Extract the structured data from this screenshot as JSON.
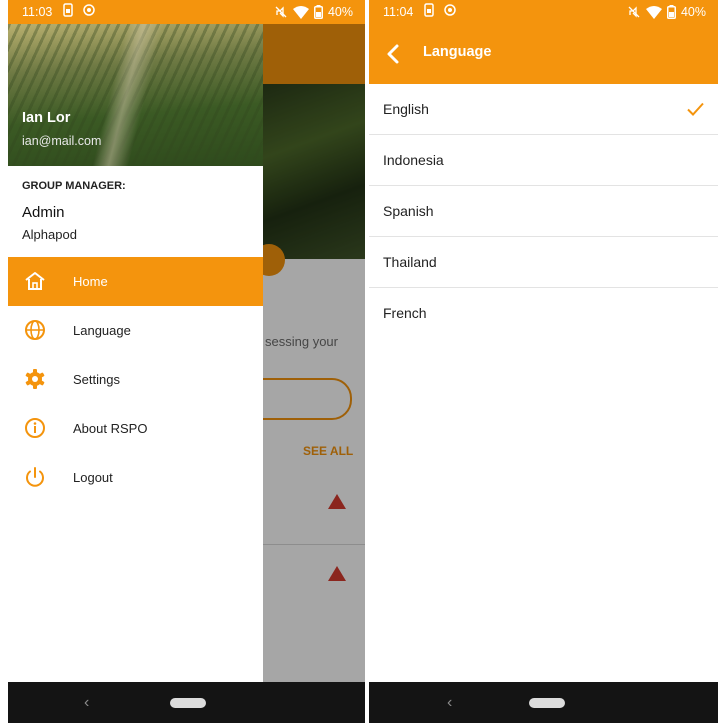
{
  "left_screen": {
    "status": {
      "time": "11:03",
      "battery": "40%"
    },
    "drawer": {
      "user_name": "Ian Lor",
      "user_email": "ian@mail.com",
      "group_label": "GROUP MANAGER:",
      "role": "Admin",
      "organization": "Alphapod",
      "menu": [
        {
          "label": "Home",
          "icon": "home-icon",
          "active": true
        },
        {
          "label": "Language",
          "icon": "globe-icon",
          "active": false
        },
        {
          "label": "Settings",
          "icon": "gear-icon",
          "active": false
        },
        {
          "label": "About RSPO",
          "icon": "info-icon",
          "active": false
        },
        {
          "label": "Logout",
          "icon": "power-icon",
          "active": false
        }
      ]
    },
    "behind": {
      "prompt_fragment": "sessing your",
      "see_all": "SEE ALL"
    }
  },
  "right_screen": {
    "status": {
      "time": "11:04",
      "battery": "40%"
    },
    "title": "Language",
    "languages": [
      {
        "label": "English",
        "selected": true
      },
      {
        "label": "Indonesia",
        "selected": false
      },
      {
        "label": "Spanish",
        "selected": false
      },
      {
        "label": "Thailand",
        "selected": false
      },
      {
        "label": "French",
        "selected": false
      }
    ]
  },
  "colors": {
    "accent": "#f4940d",
    "nav_bar": "#141414",
    "warning": "#d63b2f"
  }
}
